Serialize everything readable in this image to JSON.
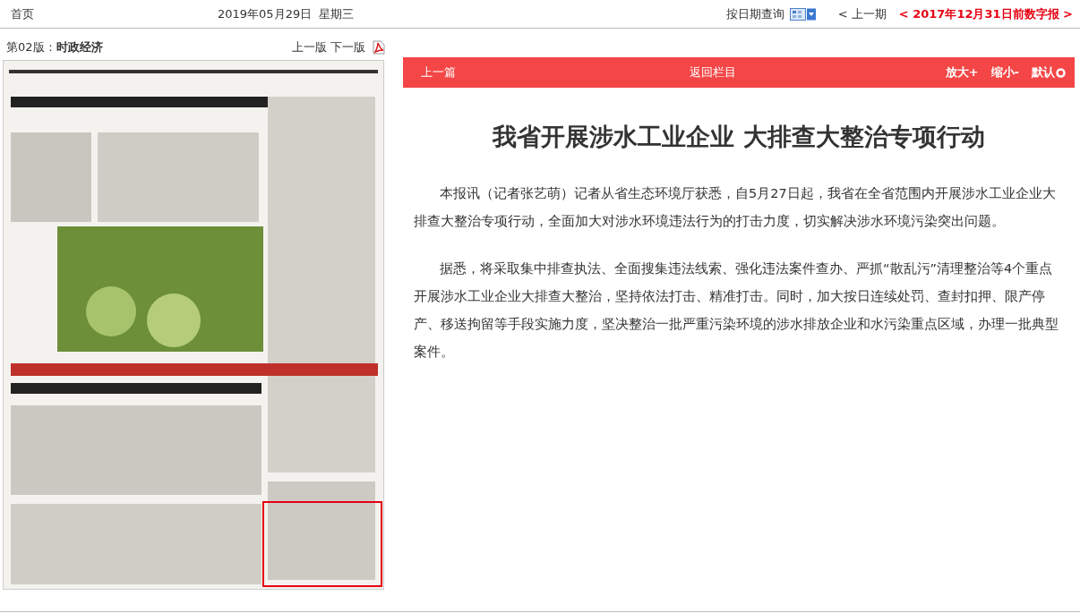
{
  "top_bar": {
    "home": "首页",
    "date": "2019年05月29日",
    "weekday": "星期三",
    "date_query": "按日期查询",
    "prev_issue": "< 上一期",
    "archive_link": "< 2017年12月31日前数字报 >"
  },
  "page_panel": {
    "page_no": "第02版：",
    "page_name": "时政经济",
    "prev_page": "上一版",
    "next_page": "下一版"
  },
  "article_toolbar": {
    "prev_article": "上一篇",
    "back": "返回栏目",
    "zoom_in": "放大+",
    "zoom_out": "缩小-",
    "reset": "默认"
  },
  "article": {
    "title": "我省开展涉水工业企业 大排查大整治专项行动",
    "paragraphs": [
      "本报讯（记者张艺萌）记者从省生态环境厅获悉，自5月27日起，我省在全省范围内开展涉水工业企业大排查大整治专项行动，全面加大对涉水环境违法行为的打击力度，切实解决涉水环境污染突出问题。",
      "据悉，将采取集中排查执法、全面搜集违法线索、强化违法案件查办、严抓“散乱污”清理整治等4个重点开展涉水工业企业大排查大整治，坚持依法打击、精准打击。同时，加大按日连续处罚、查封扣押、限产停产、移送拘留等手段实施力度，坚决整治一批严重污染环境的涉水排放企业和水污染重点区域，办理一批典型案件。"
    ]
  }
}
